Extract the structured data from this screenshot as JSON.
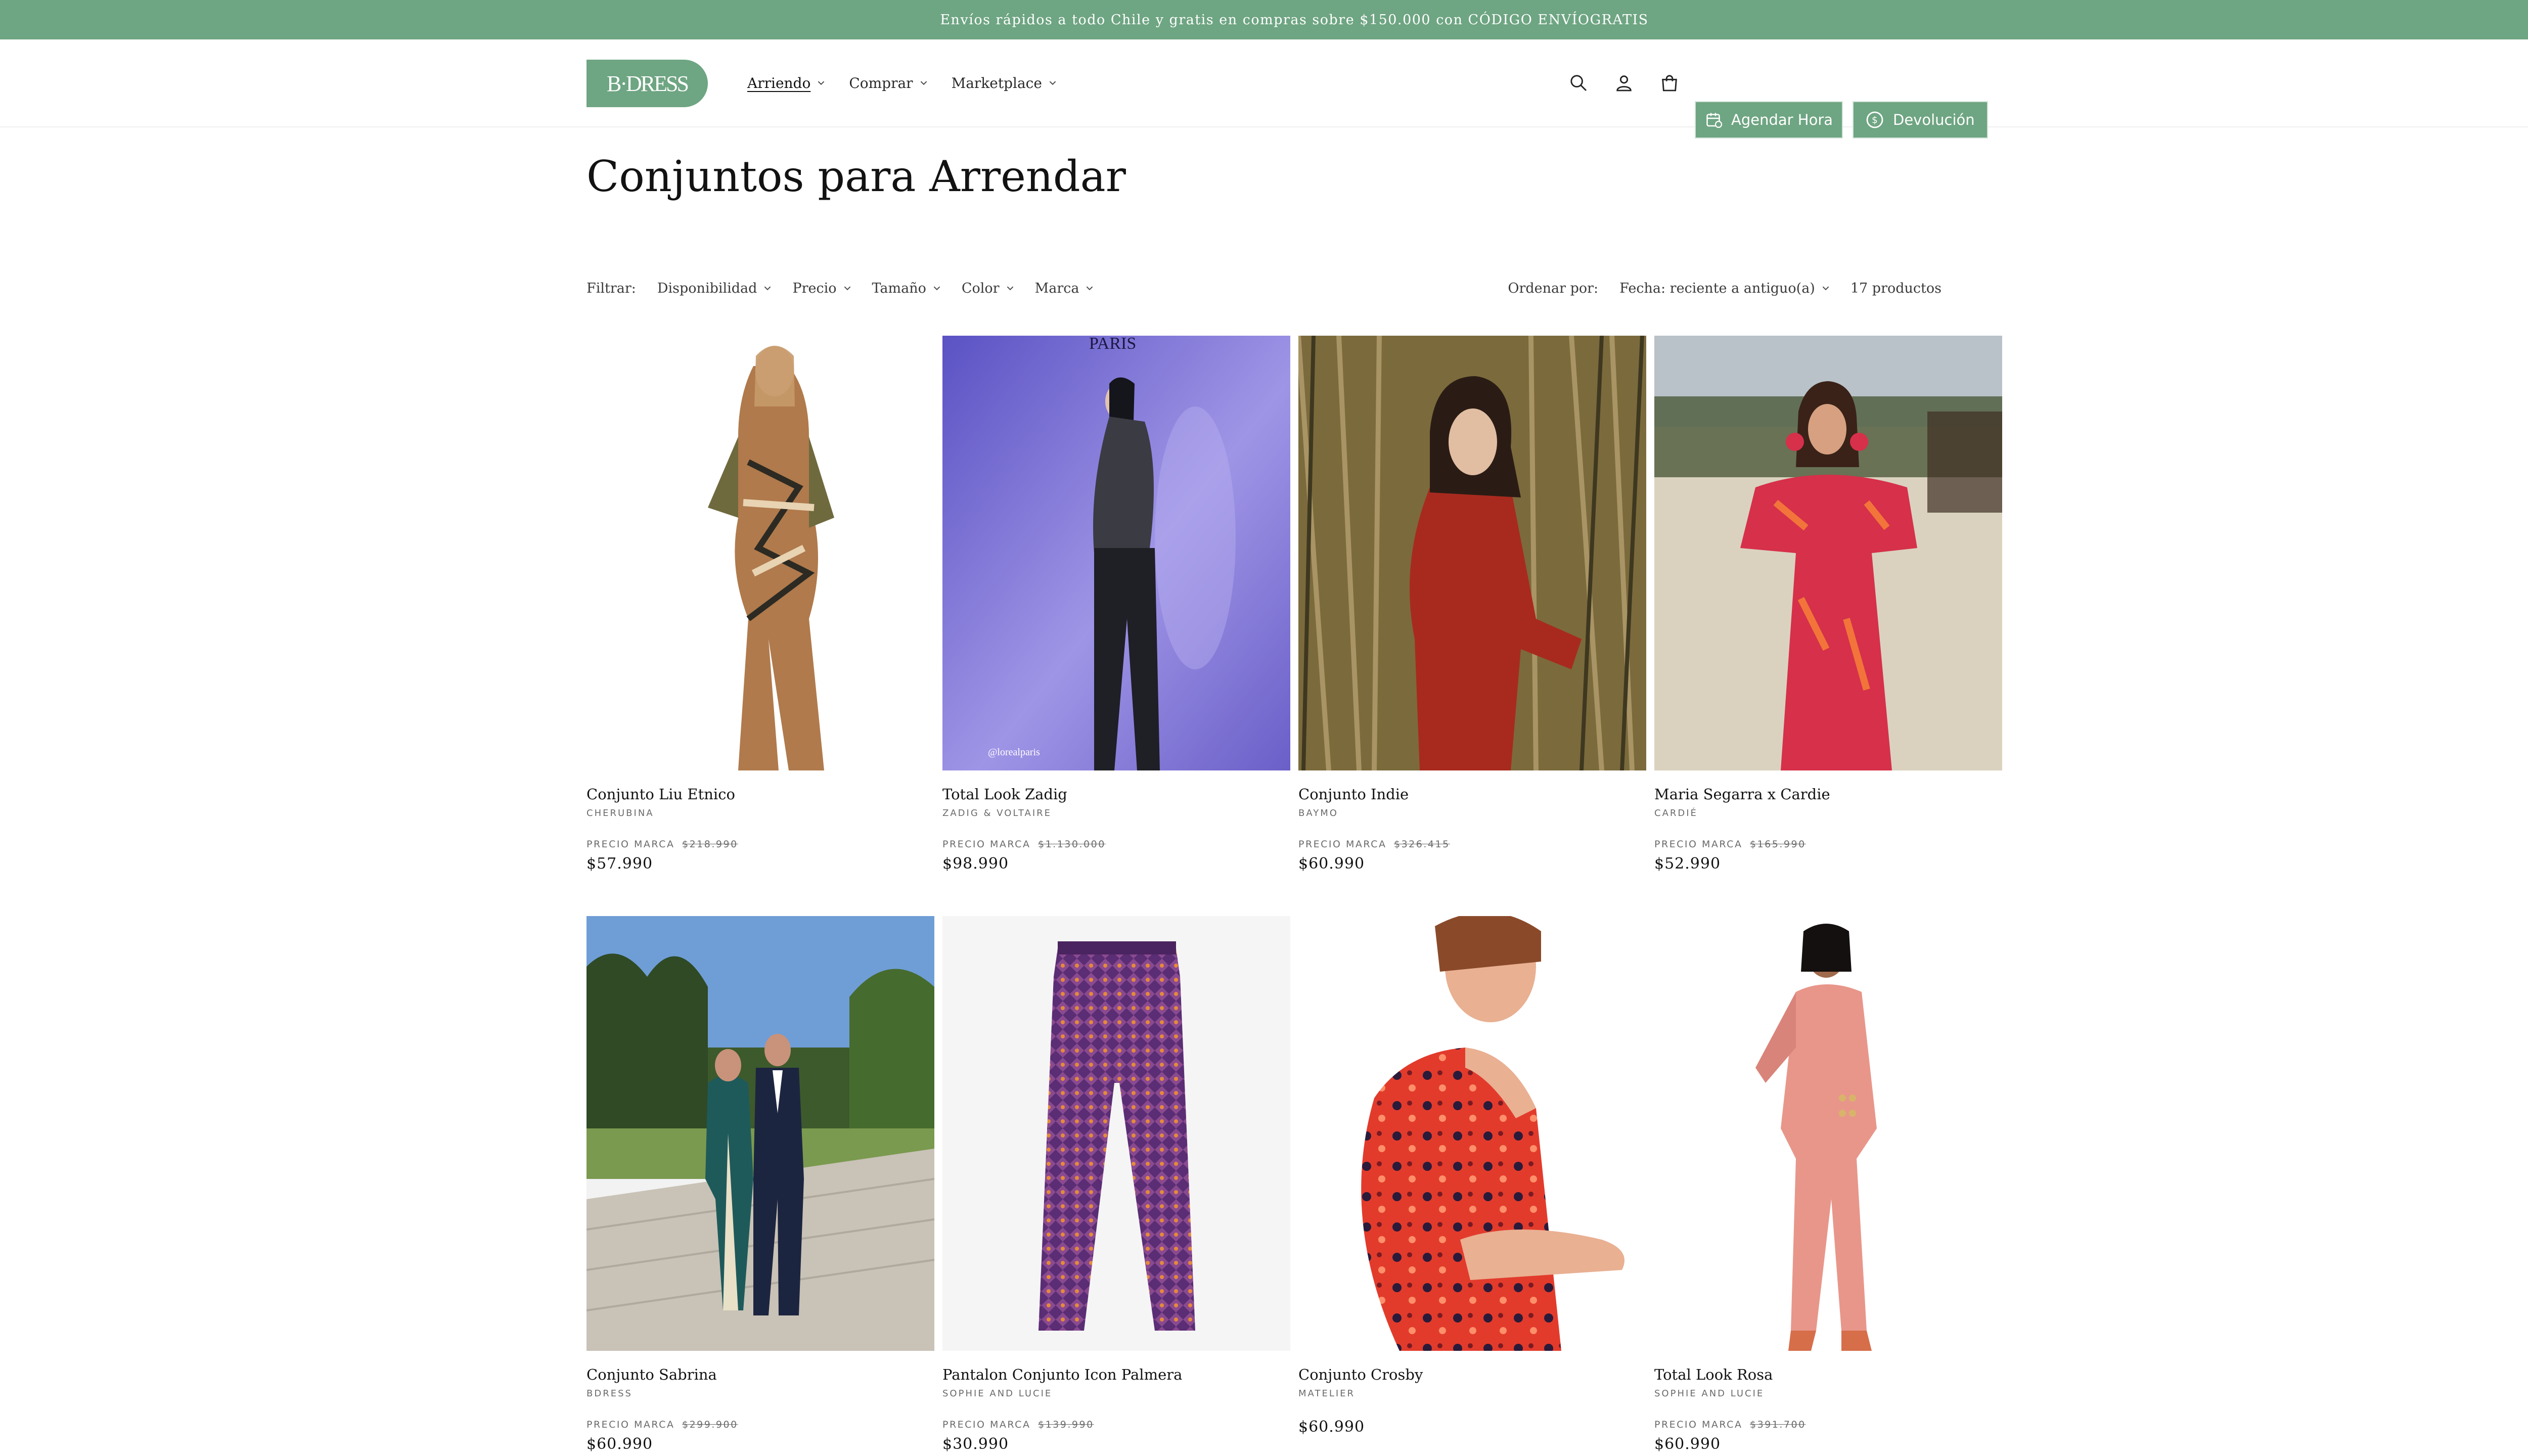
{
  "announcement": "Envíos rápidos a todo Chile y gratis en compras sobre $150.000 con CÓDIGO ENVÍOGRATIS",
  "header": {
    "logo_text": "B·DRESS",
    "nav": [
      {
        "label": "Arriendo"
      },
      {
        "label": "Comprar"
      },
      {
        "label": "Marketplace"
      }
    ],
    "agendar_label": "Agendar Hora",
    "devolucion_label": "Devolución"
  },
  "icons": {
    "search": "search-icon",
    "account": "user-icon",
    "cart": "bag-icon",
    "calendar": "calendar-icon",
    "return": "return-icon"
  },
  "colors": {
    "brand_green": "#6ea582",
    "text": "#121212",
    "muted": "#6a6a6a"
  },
  "page": {
    "title": "Conjuntos para Arrendar"
  },
  "filters": {
    "label": "Filtrar:",
    "items": [
      "Disponibilidad",
      "Precio",
      "Tamaño",
      "Color",
      "Marca"
    ]
  },
  "sort": {
    "label": "Ordenar por:",
    "value": "Fecha: reciente a antiguo(a)",
    "count": "17 productos"
  },
  "products": [
    {
      "name": "Conjunto Liu Etnico",
      "brand": "CHERUBINA",
      "was_label": "PRECIO MARCA",
      "was": "$218.990",
      "price": "$57.990"
    },
    {
      "name": "Total Look Zadig",
      "brand": "ZADIG & VOLTAIRE",
      "was_label": "PRECIO MARCA",
      "was": "$1.130.000",
      "price": "$98.990"
    },
    {
      "name": "Conjunto Indie",
      "brand": "BAYMO",
      "was_label": "PRECIO MARCA",
      "was": "$326.415",
      "price": "$60.990"
    },
    {
      "name": "Maria Segarra x Cardie",
      "brand": "CARDIÉ",
      "was_label": "PRECIO MARCA",
      "was": "$165.990",
      "price": "$52.990"
    },
    {
      "name": "Conjunto Sabrina",
      "brand": "BDRESS",
      "was_label": "PRECIO MARCA",
      "was": "$299.900",
      "price": "$60.990"
    },
    {
      "name": "Pantalon Conjunto Icon Palmera",
      "brand": "SOPHIE AND LUCIE",
      "was_label": "PRECIO MARCA",
      "was": "$139.990",
      "price": "$30.990"
    },
    {
      "name": "Conjunto Crosby",
      "brand": "MATELIER",
      "price": "$60.990"
    },
    {
      "name": "Total Look Rosa",
      "brand": "SOPHIE AND LUCIE",
      "was_label": "PRECIO MARCA",
      "was": "$391.700",
      "price": "$60.990"
    }
  ],
  "image_texts": {
    "zadig_top": "PARIS",
    "zadig_caption": "@lorealparis"
  }
}
